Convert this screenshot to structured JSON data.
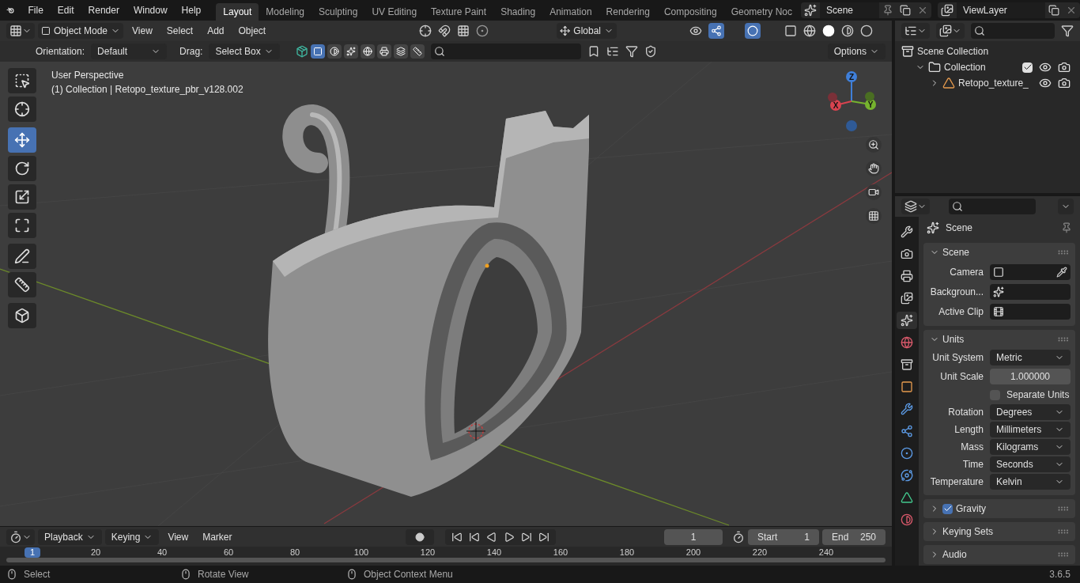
{
  "menu": [
    "File",
    "Edit",
    "Render",
    "Window",
    "Help"
  ],
  "workspaces": [
    {
      "label": "Layout",
      "selected": true
    },
    {
      "label": "Modeling",
      "selected": false
    },
    {
      "label": "Sculpting",
      "selected": false
    },
    {
      "label": "UV Editing",
      "selected": false
    },
    {
      "label": "Texture Paint",
      "selected": false
    },
    {
      "label": "Shading",
      "selected": false
    },
    {
      "label": "Animation",
      "selected": false
    },
    {
      "label": "Rendering",
      "selected": false
    },
    {
      "label": "Compositing",
      "selected": false
    },
    {
      "label": "Geometry Noc",
      "selected": false
    }
  ],
  "scene": "Scene",
  "view_layer": "ViewLayer",
  "viewport_header": {
    "mode": "Object Mode",
    "menus": [
      "View",
      "Select",
      "Add",
      "Object"
    ],
    "transform_orientation": "Global"
  },
  "tool_settings": {
    "orientation_label": "Orientation:",
    "orientation": "Default",
    "drag_label": "Drag:",
    "drag": "Select Box",
    "options": "Options"
  },
  "tools": [
    {
      "kind": "select",
      "selected": false
    },
    {
      "kind": "cursor",
      "selected": false
    },
    {
      "kind": "move",
      "selected": true
    },
    {
      "kind": "rotate",
      "selected": false
    },
    {
      "kind": "scale",
      "selected": false
    },
    {
      "kind": "transform",
      "selected": false
    },
    {
      "kind": "annotate",
      "selected": false
    },
    {
      "kind": "measure",
      "selected": false
    },
    {
      "kind": "add-cube",
      "selected": false
    }
  ],
  "viewport_info": [
    "User Perspective",
    "(1) Collection | Retopo_texture_pbr_v128.002"
  ],
  "gizmo": {
    "z": "Z",
    "x": "X",
    "y": "Y"
  },
  "outliner": {
    "items": [
      {
        "label": "Scene Collection",
        "kind": "scene-collection",
        "children": [
          {
            "label": "Collection",
            "kind": "collection",
            "checked": true,
            "expanded": true,
            "children": [
              {
                "label": "Retopo_texture_",
                "kind": "mesh",
                "expanded": false
              }
            ]
          }
        ]
      }
    ]
  },
  "properties": {
    "tabs": [
      {
        "kind": "tool",
        "selected": false
      },
      {
        "kind": "render",
        "selected": false
      },
      {
        "kind": "output",
        "selected": false
      },
      {
        "kind": "view-layer",
        "selected": false
      },
      {
        "kind": "scene",
        "selected": true
      },
      {
        "kind": "world",
        "selected": false
      },
      {
        "kind": "collection",
        "selected": false
      },
      {
        "kind": "object",
        "selected": false
      },
      {
        "kind": "modifier",
        "selected": false
      },
      {
        "kind": "particles",
        "selected": false
      },
      {
        "kind": "physics",
        "selected": false
      },
      {
        "kind": "constraints",
        "selected": false
      },
      {
        "kind": "data",
        "selected": false
      },
      {
        "kind": "material",
        "selected": false
      }
    ],
    "title": "Scene",
    "panels": [
      {
        "title": "Scene",
        "expanded": true,
        "rows": [
          {
            "kind": "id",
            "label": "Camera"
          },
          {
            "kind": "id",
            "label": "Backgroun..."
          },
          {
            "kind": "id",
            "label": "Active Clip"
          }
        ]
      },
      {
        "title": "Units",
        "expanded": true,
        "rows": [
          {
            "kind": "dropdown",
            "label": "Unit System",
            "value": "Metric"
          },
          {
            "kind": "number",
            "label": "Unit Scale",
            "value": "1.000000"
          },
          {
            "kind": "checkbox",
            "label": "Separate Units",
            "checked": false
          },
          {
            "kind": "dropdown",
            "label": "Rotation",
            "value": "Degrees"
          },
          {
            "kind": "dropdown",
            "label": "Length",
            "value": "Millimeters"
          },
          {
            "kind": "dropdown",
            "label": "Mass",
            "value": "Kilograms"
          },
          {
            "kind": "dropdown",
            "label": "Time",
            "value": "Seconds"
          },
          {
            "kind": "dropdown",
            "label": "Temperature",
            "value": "Kelvin"
          }
        ]
      },
      {
        "title": "Gravity",
        "expanded": false,
        "checked": true
      },
      {
        "title": "Keying Sets",
        "expanded": false
      },
      {
        "title": "Audio",
        "expanded": false
      }
    ]
  },
  "timeline": {
    "menus": [
      "Playback",
      "Keying",
      "View",
      "Marker"
    ],
    "current_frame": "1",
    "start_label": "Start",
    "start": "1",
    "end_label": "End",
    "end": "250",
    "ruler_current": "1",
    "ruler": [
      "20",
      "40",
      "60",
      "80",
      "100",
      "120",
      "140",
      "160",
      "180",
      "200",
      "220",
      "240"
    ]
  },
  "status_bar": {
    "hints": [
      "Select",
      "Rotate View",
      "Object Context Menu"
    ],
    "version": "3.6.5"
  }
}
